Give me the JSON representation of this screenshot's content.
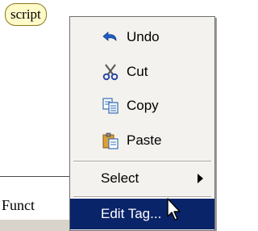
{
  "document": {
    "tag_label": "script",
    "text": "Funct"
  },
  "context_menu": {
    "items": [
      {
        "label": "Undo",
        "icon": "undo-icon"
      },
      {
        "label": "Cut",
        "icon": "scissors-icon"
      },
      {
        "label": "Copy",
        "icon": "copy-icon"
      },
      {
        "label": "Paste",
        "icon": "clipboard-paste-icon"
      },
      {
        "label": "Select",
        "icon": "",
        "has_submenu": true
      },
      {
        "label": "Edit Tag...",
        "icon": "",
        "selected": true
      }
    ]
  },
  "colors": {
    "menu_background": "#f4f2ee",
    "selection": "#0a246a",
    "tag_fill": "#fffbc8"
  }
}
